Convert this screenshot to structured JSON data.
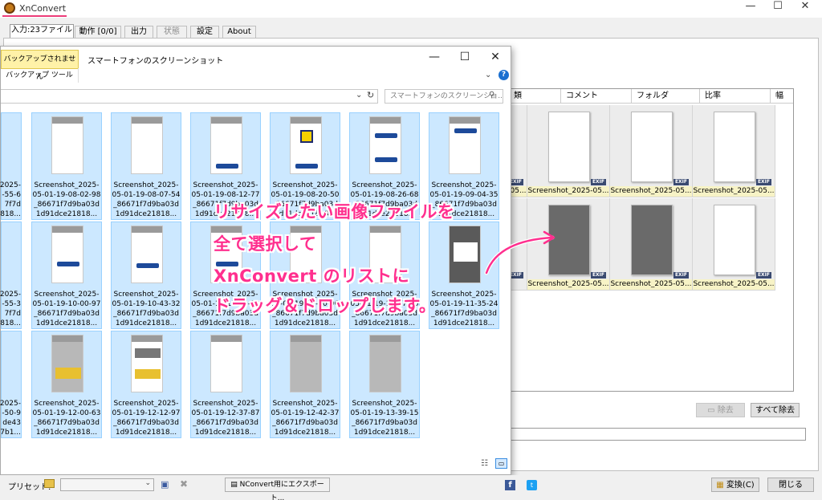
{
  "app": {
    "title": "XnConvert"
  },
  "window_controls": {
    "minimize": "—",
    "maximize": "☐",
    "close": "✕"
  },
  "tabs": [
    {
      "label": "入力:23ファイル",
      "active": true
    },
    {
      "label": "動作 [0/0]"
    },
    {
      "label": "出力"
    },
    {
      "label": "状態",
      "disabled": true
    },
    {
      "label": "設定"
    },
    {
      "label": "About"
    }
  ],
  "file_list": {
    "columns": [
      "類",
      "コメント",
      "フォルダ",
      "比率",
      "幅"
    ],
    "rows": [
      [
        "Screenshot_2025-05...",
        "Screenshot_2025-05...",
        "Screenshot_2025-05...",
        "Screenshot_2025-05..."
      ],
      [
        "Screenshot_2025-05...",
        "Screenshot_2025-05...",
        "Screenshot_2025-05..."
      ]
    ],
    "exif_badge": "EXIF",
    "remove_label": "除去",
    "remove_all_label": "すべて除去"
  },
  "explorer": {
    "title": "スマートフォンのスクリーンショット",
    "backup_badge": "バックアップされません",
    "backup_tool": "バックアップ ツール",
    "search_placeholder": "スマートフォンのスクリーンショ...",
    "partial_files": [
      "2025-\n-55-6\n7f7d\n1818...",
      "2025-\n-55-3\n7f7d\n1818...",
      "2025-\n-50-9\nde43\n7b1..."
    ],
    "files": [
      [
        "Screenshot_2025-05-01-19-08-02-98_86671f7d9ba03d1d91dce21818...",
        "Screenshot_2025-05-01-19-08-07-54_86671f7d9ba03d1d91dce21818...",
        "Screenshot_2025-05-01-19-08-12-77_86671f7d9ba03d1d91dce21818...",
        "Screenshot_2025-05-01-19-08-20-50_86671f7d9ba03d1d91dce21818...",
        "Screenshot_2025-05-01-19-08-26-68_86671f7d9ba03d1d91dce21818...",
        "Screenshot_2025-05-01-19-09-04-35_86671f7d9ba03d1d91dce21818..."
      ],
      [
        "Screenshot_2025-05-01-19-10-00-97_86671f7d9ba03d1d91dce21818...",
        "Screenshot_2025-05-01-19-10-43-32_86671f7d9ba03d1d91dce21818...",
        "Screenshot_2025-05-01-19-11-00-00_86671f7d9ba03d1d91dce21818...",
        "Screenshot_2025-05-01-19-11-10-00_86671f7d9ba03d1d91dce21818...",
        "Screenshot_2025-05-01-19-11-17-00_86671f7d9ba03d1d91dce21818...",
        "Screenshot_2025-05-01-19-11-35-24_86671f7d9ba03d1d91dce21818..."
      ],
      [
        "Screenshot_2025-05-01-19-12-00-63_86671f7d9ba03d1d91dce21818...",
        "Screenshot_2025-05-01-19-12-12-97_86671f7d9ba03d1d91dce21818...",
        "Screenshot_2025-05-01-19-12-37-87_86671f7d9ba03d1d91dce21818...",
        "Screenshot_2025-05-01-19-12-42-37_86671f7d9ba03d1d91dce21818...",
        "Screenshot_2025-05-01-19-13-39-15_86671f7d9ba03d1d91dce21818..."
      ]
    ]
  },
  "overlay_text": [
    "リサイズしたい画像ファイルを",
    "全て選択して",
    "XnConvert のリストに",
    "ドラッグ＆ドロップします。"
  ],
  "bottom": {
    "preset_label": "プリセット:",
    "export_label": "NConvert用にエクスポート...",
    "convert_label": "変換(C)",
    "close_label": "閉じる",
    "facebook": "f",
    "twitter": "t"
  },
  "colors": {
    "accent": "#ec3d7a",
    "overlay_text": "#ff2f8e",
    "selection": "#cce8ff",
    "thumb_label_bg": "#f7f3c6"
  }
}
